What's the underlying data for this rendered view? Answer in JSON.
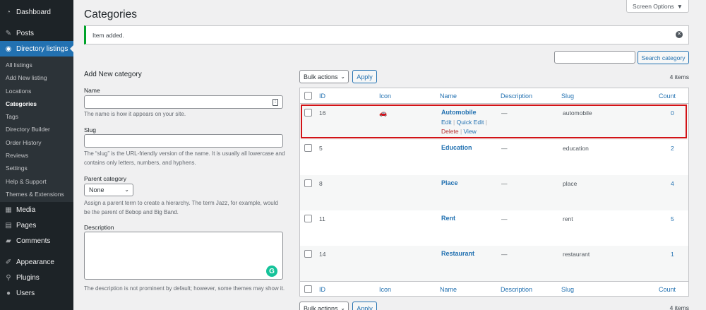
{
  "sidebar": {
    "menu_top": [
      {
        "label": "Dashboard",
        "icon": "dashboard-icon"
      },
      {
        "label": "Posts",
        "icon": "pushpin-icon"
      },
      {
        "label": "Directory listings",
        "icon": "listings-icon"
      }
    ],
    "submenu": [
      "All listings",
      "Add New listing",
      "Locations",
      "Categories",
      "Tags",
      "Directory Builder",
      "Order History",
      "Reviews",
      "Settings",
      "Help & Support",
      "Themes & Extensions"
    ],
    "current_sub": "Categories",
    "menu_bottom": [
      {
        "label": "Media",
        "icon": "media-icon"
      },
      {
        "label": "Pages",
        "icon": "pages-icon"
      },
      {
        "label": "Comments",
        "icon": "comments-icon"
      },
      {
        "label": "Appearance",
        "icon": "appearance-icon"
      },
      {
        "label": "Plugins",
        "icon": "plugins-icon"
      },
      {
        "label": "Users",
        "icon": "users-icon"
      }
    ]
  },
  "page": {
    "title": "Categories",
    "screen_options": "Screen Options",
    "notice": "Item added."
  },
  "search": {
    "button": "Search category"
  },
  "form": {
    "title": "Add New category",
    "name_label": "Name",
    "name_help": "The name is how it appears on your site.",
    "slug_label": "Slug",
    "slug_help": "The “slug” is the URL-friendly version of the name. It is usually all lowercase and contains only letters, numbers, and hyphens.",
    "parent_label": "Parent category",
    "parent_value": "None",
    "parent_help": "Assign a parent term to create a hierarchy. The term Jazz, for example, would be the parent of Bebop and Big Band.",
    "description_label": "Description",
    "description_help": "The description is not prominent by default; however, some themes may show it."
  },
  "list": {
    "bulk_actions": "Bulk actions",
    "apply": "Apply",
    "items_count": "4 items",
    "columns": [
      "ID",
      "Icon",
      "Name",
      "Description",
      "Slug",
      "Count"
    ],
    "rows": [
      {
        "id": "16",
        "name": "Automobile",
        "description": "—",
        "slug": "automobile",
        "count": "0",
        "has_icon": true
      },
      {
        "id": "5",
        "name": "Education",
        "description": "—",
        "slug": "education",
        "count": "2",
        "has_icon": false
      },
      {
        "id": "8",
        "name": "Place",
        "description": "—",
        "slug": "place",
        "count": "4",
        "has_icon": false
      },
      {
        "id": "11",
        "name": "Rent",
        "description": "—",
        "slug": "rent",
        "count": "5",
        "has_icon": false
      },
      {
        "id": "14",
        "name": "Restaurant",
        "description": "—",
        "slug": "restaurant",
        "count": "1",
        "has_icon": false
      }
    ],
    "row_actions": {
      "edit": "Edit",
      "quick_edit": "Quick Edit",
      "delete": "Delete",
      "view": "View"
    }
  },
  "colors": {
    "accent": "#2271b1",
    "sidebar_bg": "#1d2327",
    "notice_success": "#00a32a",
    "highlight": "#d21317"
  }
}
